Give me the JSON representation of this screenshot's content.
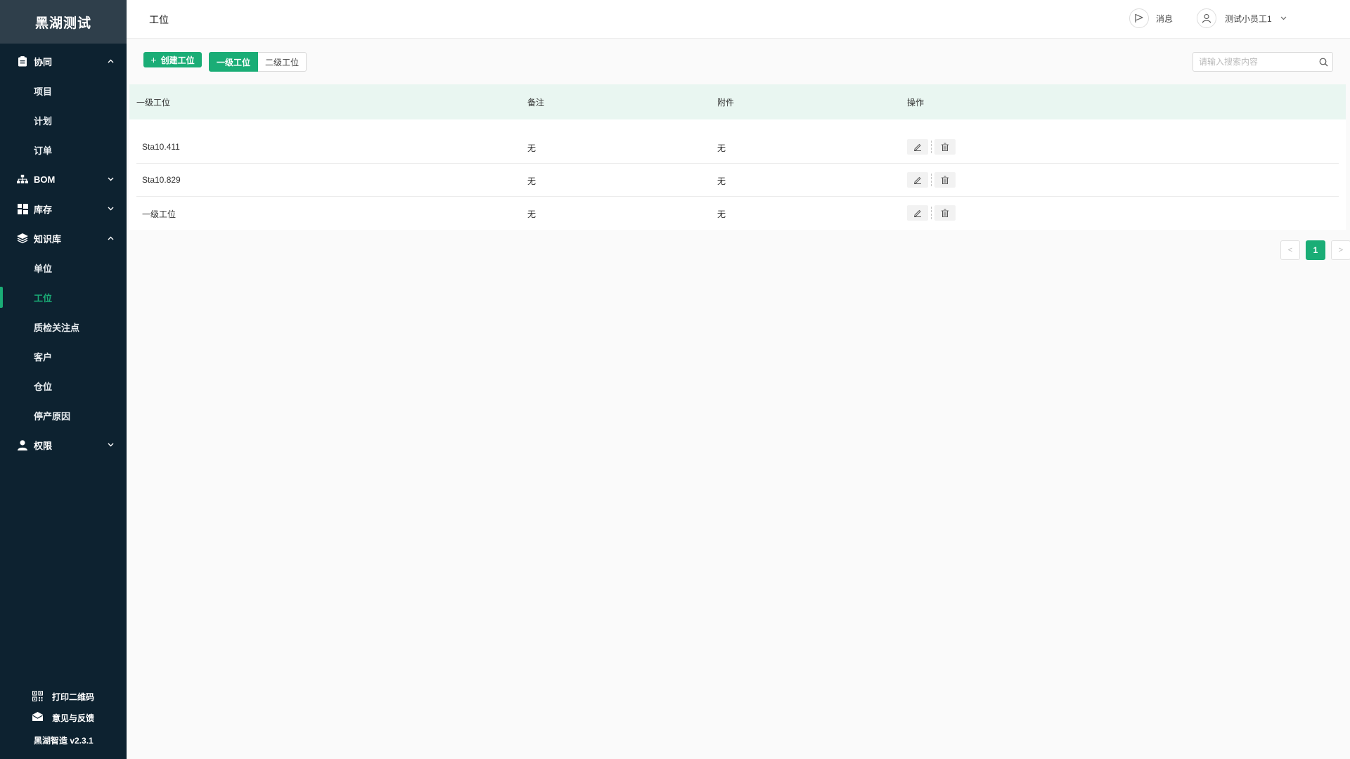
{
  "app": {
    "brand": "黑湖测试",
    "version": "黑湖智造 v2.3.1"
  },
  "sidebar": {
    "groups": [
      {
        "label": "协同",
        "icon": "clipboard-icon",
        "expanded": true,
        "items": [
          "项目",
          "计划",
          "订单"
        ]
      },
      {
        "label": "BOM",
        "icon": "hierarchy-icon",
        "expanded": false,
        "items": []
      },
      {
        "label": "库存",
        "icon": "grid-icon",
        "expanded": false,
        "items": []
      },
      {
        "label": "知识库",
        "icon": "layers-icon",
        "expanded": true,
        "items": [
          "单位",
          "工位",
          "质检关注点",
          "客户",
          "仓位",
          "停产原因"
        ]
      },
      {
        "label": "权限",
        "icon": "user-icon",
        "expanded": false,
        "items": []
      }
    ],
    "active_item": "工位",
    "bottom": {
      "print_qr": "打印二维码",
      "feedback": "意见与反馈"
    }
  },
  "header": {
    "title": "工位",
    "messages_label": "消息",
    "user_name": "测试小员工1"
  },
  "toolbar": {
    "create_label": "创建工位",
    "seg_first": "一级工位",
    "seg_second": "二级工位",
    "search_placeholder": "请输入搜索内容"
  },
  "table": {
    "columns": [
      "一级工位",
      "备注",
      "附件",
      "操作"
    ],
    "rows": [
      {
        "name": "Sta10.411",
        "remark": "无",
        "attachment": "无"
      },
      {
        "name": "Sta10.829",
        "remark": "无",
        "attachment": "无"
      },
      {
        "name": "一级工位",
        "remark": "无",
        "attachment": "无"
      }
    ]
  },
  "pagination": {
    "prev": "<",
    "current": "1",
    "next": ">"
  },
  "colors": {
    "accent": "#1aad76",
    "sidebar_bg": "#0d2230",
    "brand_bg": "#2f3f4b",
    "table_head_bg": "#e9f6f1"
  }
}
